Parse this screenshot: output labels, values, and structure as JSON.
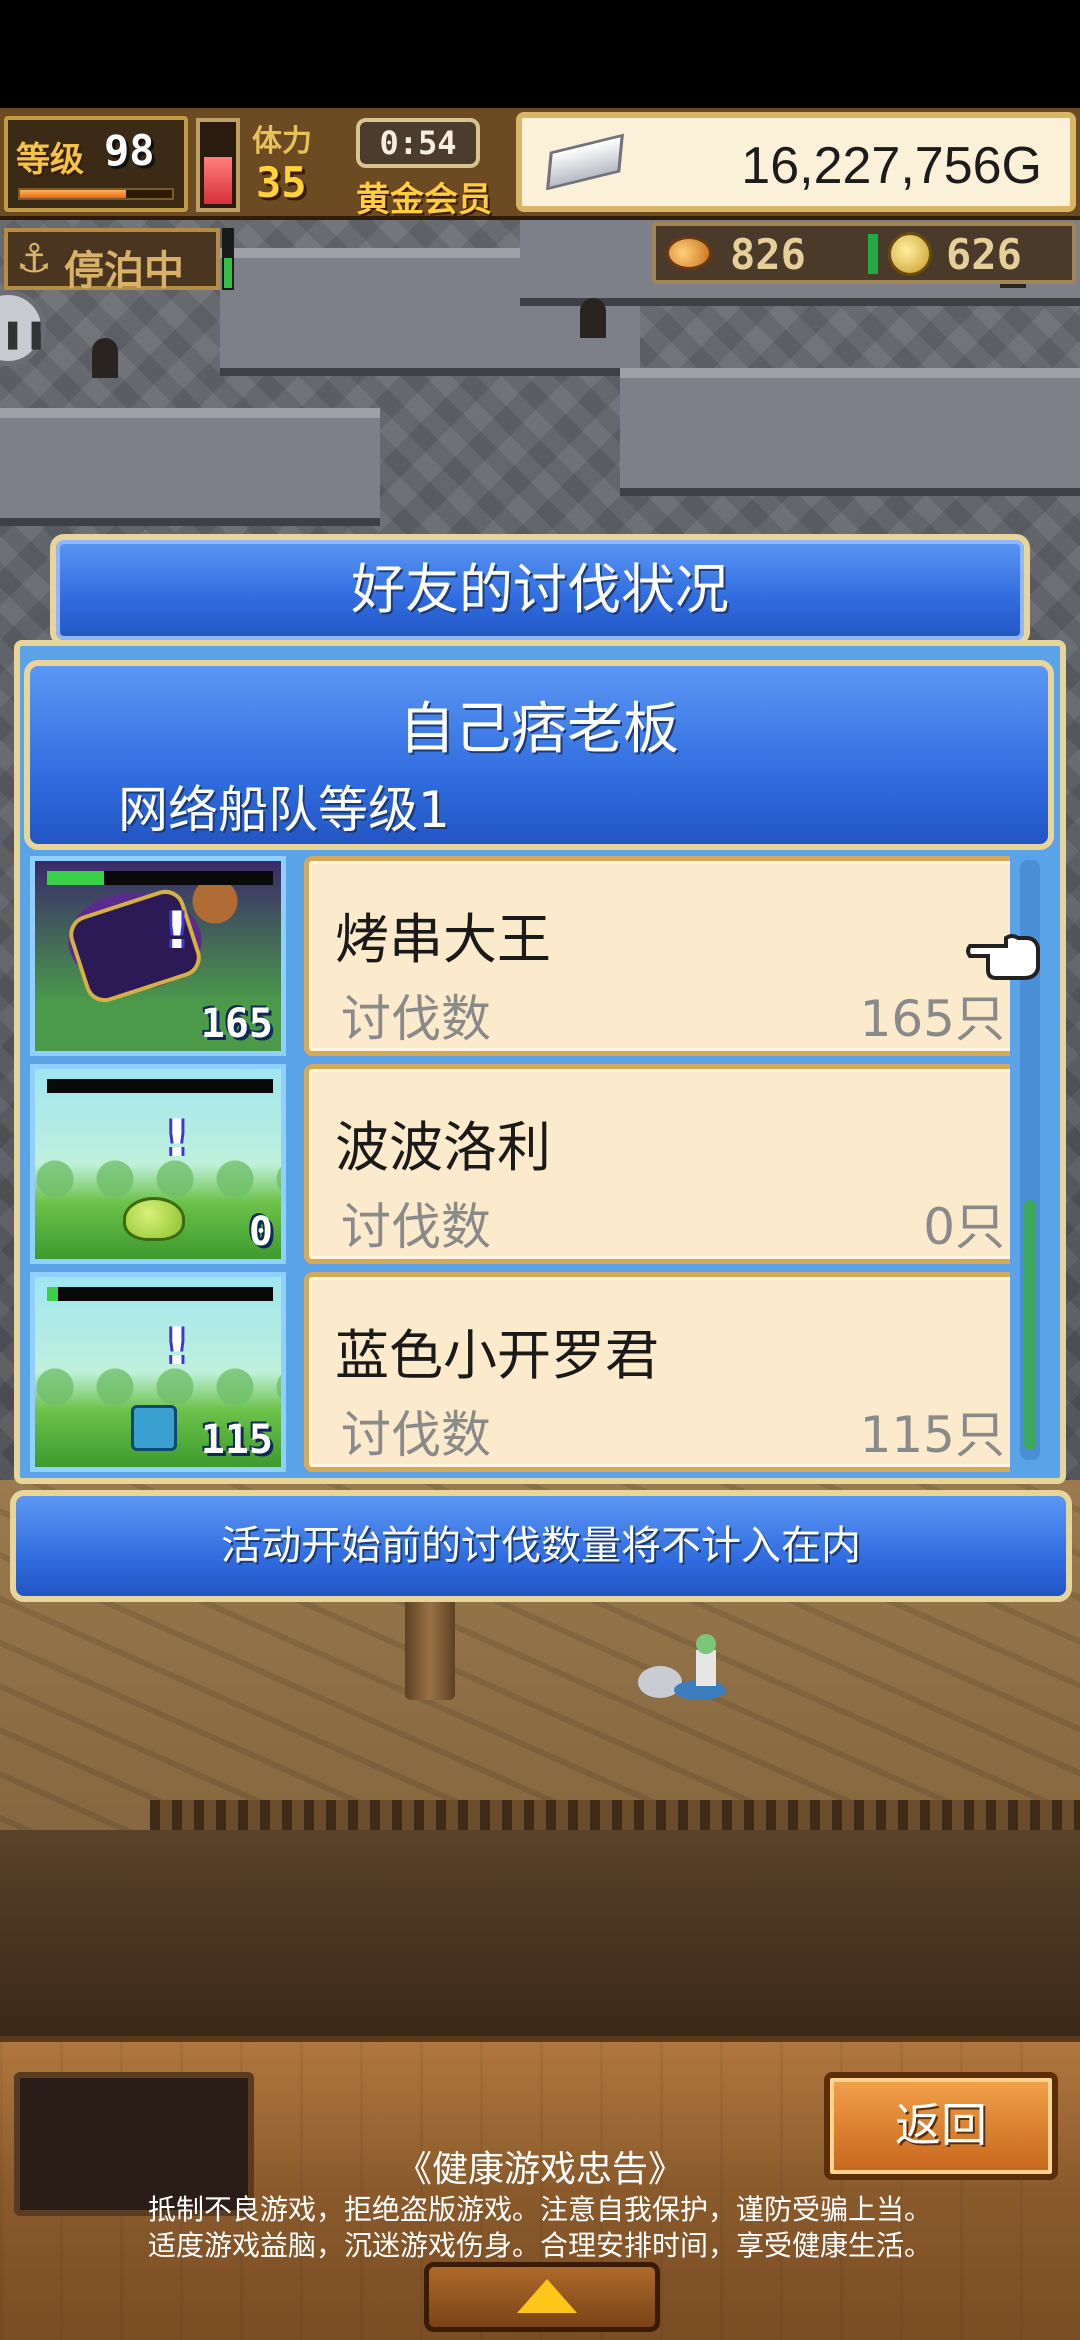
{
  "status_bar": {
    "level_label": "等级",
    "level_value": "98",
    "exp_progress": 0.7,
    "stamina_label": "体力",
    "stamina_value": "35",
    "stamina_fraction": 0.55,
    "timer": "0:54",
    "membership": "黄金会员",
    "gold": "16,227,756G"
  },
  "secondary_bar": {
    "docked_label": "停泊中",
    "resource_1": "826",
    "resource_2": "626"
  },
  "dialog": {
    "title": "好友的讨伐状况",
    "player": {
      "name": "自己痞老板",
      "fleet_level": "网络船队等级1"
    },
    "entries": [
      {
        "name": "烤串大王",
        "label": "讨伐数",
        "count": "165只",
        "thumb_count": "165",
        "hp_fraction": 0.25,
        "monster": "boss"
      },
      {
        "name": "波波洛利",
        "label": "讨伐数",
        "count": "0只",
        "thumb_count": "0",
        "hp_fraction": 0.0,
        "monster": "slime"
      },
      {
        "name": "蓝色小开罗君",
        "label": "讨伐数",
        "count": "115只",
        "thumb_count": "115",
        "hp_fraction": 0.05,
        "monster": "cairo"
      }
    ],
    "notice": "活动开始前的讨伐数量将不计入在内"
  },
  "bottom": {
    "back_label": "返回",
    "health_title": "《健康游戏忠告》",
    "health_line_1": "抵制不良游戏，拒绝盗版游戏。注意自我保护，谨防受骗上当。",
    "health_line_2": "适度游戏益脑，沉迷游戏伤身。合理安排时间，享受健康生活。"
  },
  "icons": {
    "anchor": "anchor-icon",
    "silver_bar": "silver-bar-icon",
    "fish": "fish-icon",
    "coin": "coin-icon",
    "pointer": "pointing-hand-icon",
    "expand": "up-arrow-icon"
  },
  "colors": {
    "banner_blue": "#2f6bde",
    "frame_gold": "#e8d59a",
    "card_cream": "#fbeacb",
    "wood": "#8a5a2c"
  }
}
